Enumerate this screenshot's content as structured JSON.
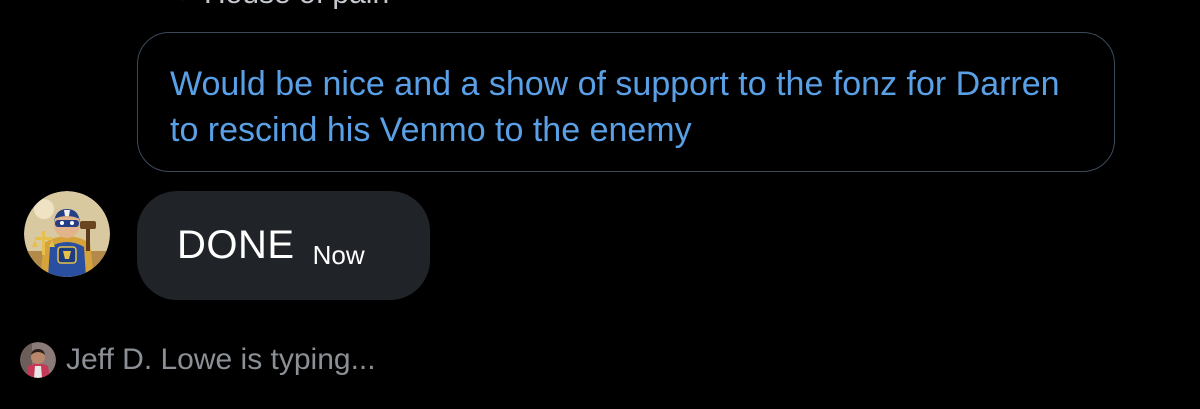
{
  "reply_context": {
    "label": "House of pain",
    "icon": "reply-arrow-icon"
  },
  "quoted_message": {
    "text": "Would be nice and a show of support to the fonz for Darren to rescind his Venmo to the enemy",
    "color": "#5aa0e6"
  },
  "message": {
    "text": "DONE",
    "time": "Now",
    "avatar_icon": "superhero-avatar",
    "bubble_color": "#202327"
  },
  "typing_indicator": {
    "text": "Jeff D. Lowe is typing...",
    "avatar_icon": "user-avatar",
    "color": "#8b9096"
  }
}
